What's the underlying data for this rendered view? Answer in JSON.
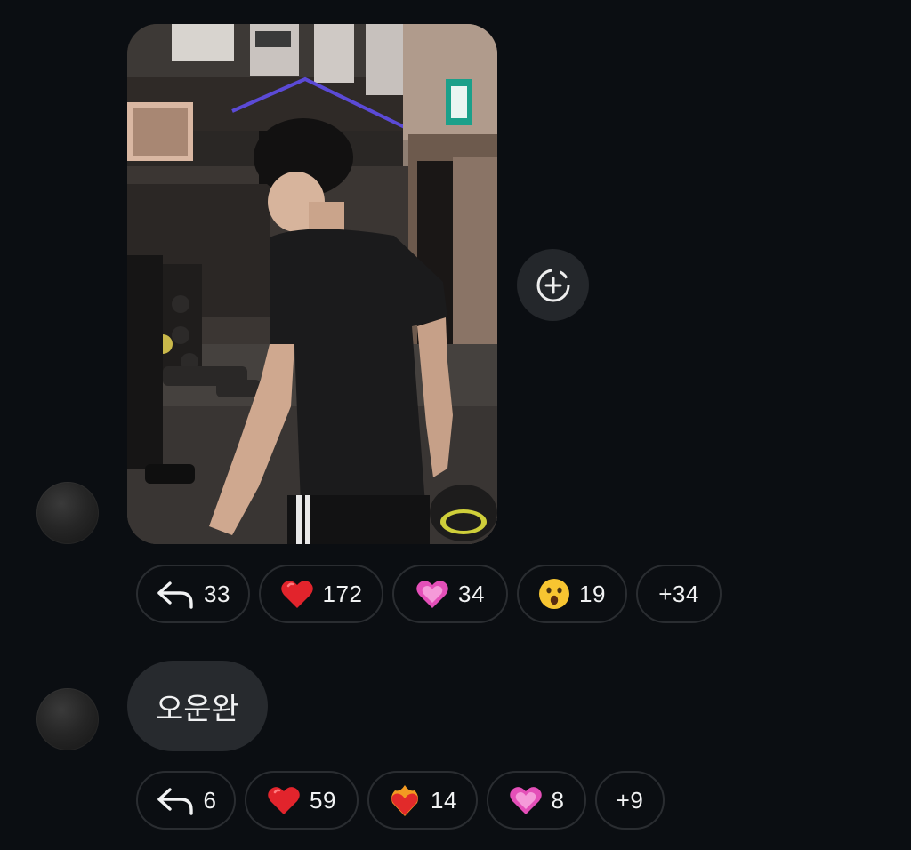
{
  "messages": [
    {
      "type": "image",
      "image_alt": "Gym mirror photo",
      "reactions": {
        "reply_count": "33",
        "items": [
          {
            "emoji": "red-heart",
            "count": "172"
          },
          {
            "emoji": "pink-heart",
            "count": "34"
          },
          {
            "emoji": "surprised-face",
            "count": "19"
          }
        ],
        "more": "+34"
      }
    },
    {
      "type": "text",
      "text": "오운완",
      "reactions": {
        "reply_count": "6",
        "items": [
          {
            "emoji": "red-heart",
            "count": "59"
          },
          {
            "emoji": "heart-on-fire",
            "count": "14"
          },
          {
            "emoji": "pink-heart",
            "count": "8"
          }
        ],
        "more": "+9"
      }
    }
  ],
  "colors": {
    "background": "#0b0e12",
    "chip_border": "#2a2d31",
    "bubble": "#272a2e",
    "add_button": "#24272b"
  }
}
